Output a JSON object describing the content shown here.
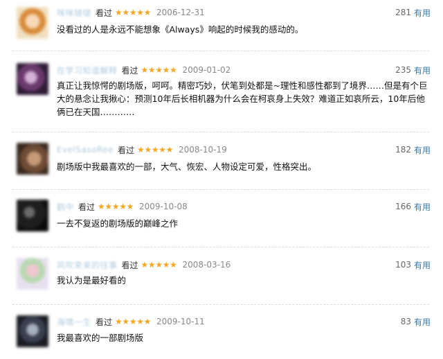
{
  "reviews": [
    {
      "username": "咪咪啵啵",
      "status": "看过",
      "rating": 5,
      "date": "2006-12-31",
      "votes": "281",
      "useful_label": "有用",
      "content": "没看过的人是永远不能想象《Always》响起的时候我的感动的。"
    },
    {
      "username": "在学习知道解释",
      "status": "看过",
      "rating": 5,
      "date": "2009-01-02",
      "votes": "235",
      "useful_label": "有用",
      "content": "真正让我惊愕的剧场版，呵呵。精密巧妙，伏笔到处都是~理性和感性都到了境界……但是有个巨大的悬念让我揪心：预测10年后长相机器为什么会在柯哀身上失效？难道正如哀所云，10年后他俩已在天国…………"
    },
    {
      "username": "EvelSasoRee",
      "status": "看过",
      "rating": 5,
      "date": "2008-10-19",
      "votes": "182",
      "useful_label": "有用",
      "content": "剧场版中我最喜欢的一部，大气、恢宏、人物设定可爱，性格突出。"
    },
    {
      "username": "鹤中",
      "status": "看过",
      "rating": 5,
      "date": "2009-10-08",
      "votes": "166",
      "useful_label": "有用",
      "content": "一去不复返的剧场版的巅峰之作"
    },
    {
      "username": "风吹来来的往事",
      "status": "看过",
      "rating": 5,
      "date": "2008-03-16",
      "votes": "103",
      "useful_label": "有用",
      "content": "我认为是最好看的"
    },
    {
      "username": "海啸一生",
      "status": "看过",
      "rating": 5,
      "date": "2009-10-11",
      "votes": "83",
      "useful_label": "有用",
      "content": "我最喜欢的一部剧场版"
    }
  ],
  "icons": {
    "star": "star-icon"
  },
  "colors": {
    "link": "#3377aa",
    "star": "#f5a623",
    "date": "#888888",
    "text": "#111111"
  }
}
